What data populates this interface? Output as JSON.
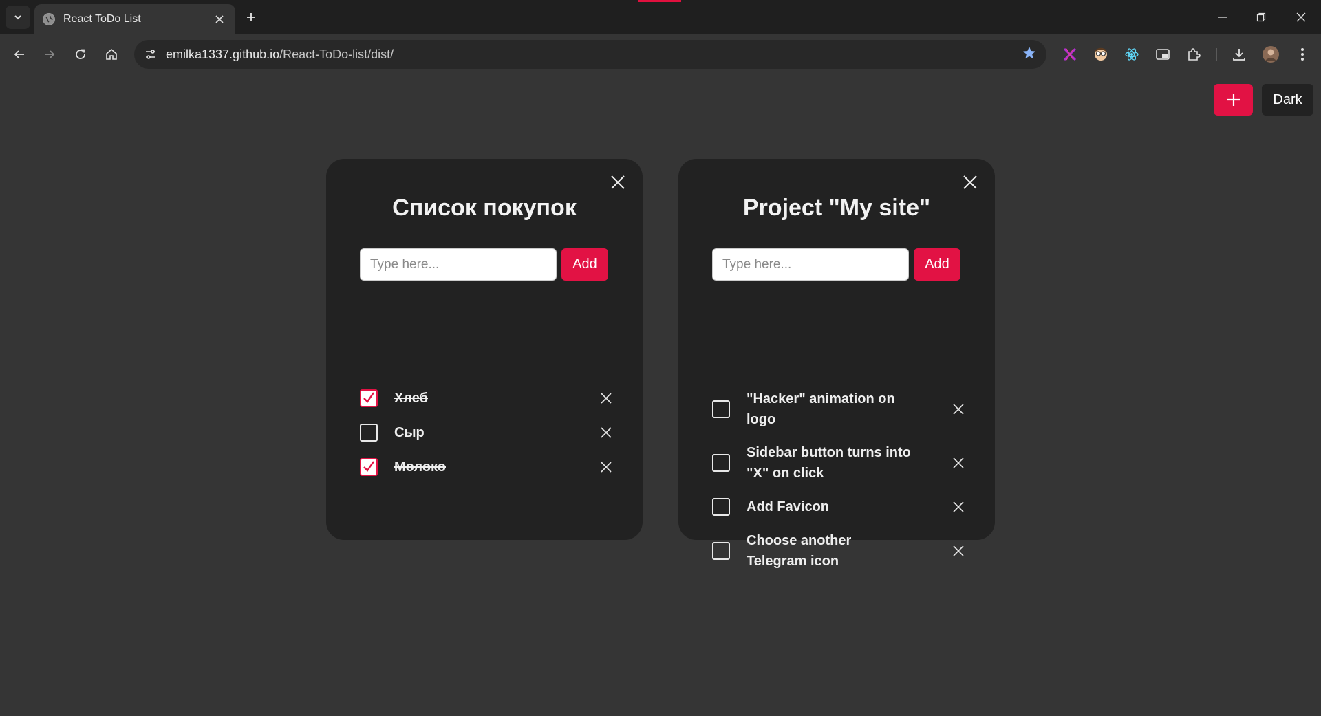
{
  "browser": {
    "tab_title": "React ToDo List",
    "url_host": "emilka1337.github.io",
    "url_path": "/React-ToDo-list/dist/"
  },
  "page": {
    "theme_label": "Dark",
    "lists": [
      {
        "title": "Список покупок",
        "input_placeholder": "Type here...",
        "add_label": "Add",
        "items": [
          {
            "text": "Хлеб",
            "done": true
          },
          {
            "text": "Сыр",
            "done": false
          },
          {
            "text": "Молоко",
            "done": true
          }
        ]
      },
      {
        "title": "Project \"My site\"",
        "input_placeholder": "Type here...",
        "add_label": "Add",
        "items": [
          {
            "text": "\"Hacker\" animation on logo",
            "done": false
          },
          {
            "text": "Sidebar button turns into \"X\" on click",
            "done": false
          },
          {
            "text": "Add Favicon",
            "done": false
          },
          {
            "text": "Choose another Telegram icon",
            "done": false
          }
        ]
      }
    ]
  },
  "colors": {
    "accent": "#e21244",
    "page_bg": "#353535",
    "card_bg": "#222222"
  }
}
